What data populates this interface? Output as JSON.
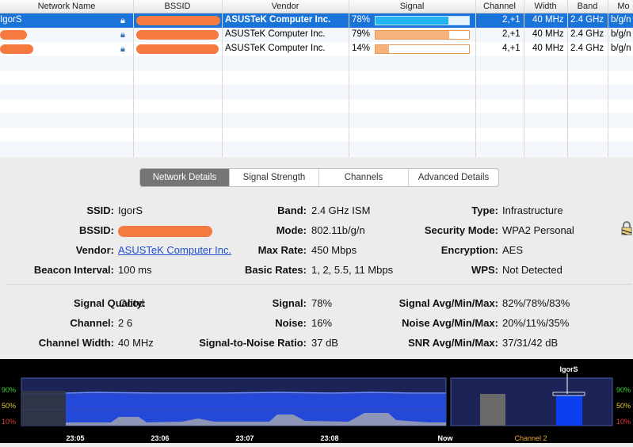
{
  "table": {
    "columns": [
      "Network Name",
      "BSSID",
      "Vendor",
      "Signal",
      "Channel",
      "Width",
      "Band",
      "Mo"
    ],
    "rows": [
      {
        "name": "IgorS",
        "vendor": "ASUSTeK Computer Inc.",
        "signal": "78%",
        "signal_value": 0.78,
        "channel": "2,+1",
        "width": "40 MHz",
        "band": "2.4 GHz",
        "mode": "b/g/n",
        "selected": true
      },
      {
        "name": "",
        "vendor": "ASUSTeK Computer Inc.",
        "signal": "79%",
        "signal_value": 0.79,
        "channel": "2,+1",
        "width": "40 MHz",
        "band": "2.4 GHz",
        "mode": "b/g/n",
        "selected": false
      },
      {
        "name": "",
        "vendor": "ASUSTeK Computer Inc.",
        "signal": "14%",
        "signal_value": 0.14,
        "channel": "4,+1",
        "width": "40 MHz",
        "band": "2.4 GHz",
        "mode": "b/g/n",
        "selected": false
      }
    ]
  },
  "tabs": [
    "Network Details",
    "Signal Strength",
    "Channels",
    "Advanced Details"
  ],
  "details": {
    "ssid_label": "SSID:",
    "ssid": "IgorS",
    "bssid_label": "BSSID:",
    "vendor_label": "Vendor:",
    "vendor": "ASUSTeK Computer Inc.",
    "beacon_label": "Beacon Interval:",
    "beacon": "100 ms",
    "band_label": "Band:",
    "band": "2.4 GHz ISM",
    "mode_label": "Mode:",
    "mode": "802.11b/g/n",
    "maxrate_label": "Max Rate:",
    "maxrate": "450 Mbps",
    "basic_label": "Basic Rates:",
    "basic": "1, 2, 5.5, 11 Mbps",
    "type_label": "Type:",
    "type": "Infrastructure",
    "security_label": "Security Mode:",
    "security": "WPA2 Personal",
    "encryption_label": "Encryption:",
    "encryption": "AES",
    "wps_label": "WPS:",
    "wps": "Not Detected"
  },
  "stats": {
    "quality_label": "Signal Quality:",
    "quality": "Good",
    "channel_label": "Channel:",
    "channel": "2 6",
    "cwidth_label": "Channel Width:",
    "cwidth": "40 MHz",
    "signal_label": "Signal:",
    "signal": "78%",
    "noise_label": "Noise:",
    "noise": "16%",
    "snr_label": "Signal-to-Noise Ratio:",
    "snr": "37 dB",
    "savg_label": "Signal Avg/Min/Max:",
    "savg": "82%/78%/83%",
    "navg_label": "Noise Avg/Min/Max:",
    "navg": "20%/11%/35%",
    "snravg_label": "SNR Avg/Min/Max:",
    "snravg": "37/31/42 dB"
  },
  "graph": {
    "levels": [
      "90%",
      "50%",
      "10%"
    ],
    "times": [
      "23:05",
      "23:06",
      "23:07",
      "23:08",
      "Now"
    ],
    "bar_label": "IgorS",
    "channel_label": "Channel 2",
    "colors": {
      "signal": "#2449d9",
      "noise": "#8e96b8",
      "level_green": "#3fcf3f",
      "level_yellow": "#e5c93a",
      "level_red": "#e03a3a",
      "label_orange": "#e8a63a"
    }
  }
}
